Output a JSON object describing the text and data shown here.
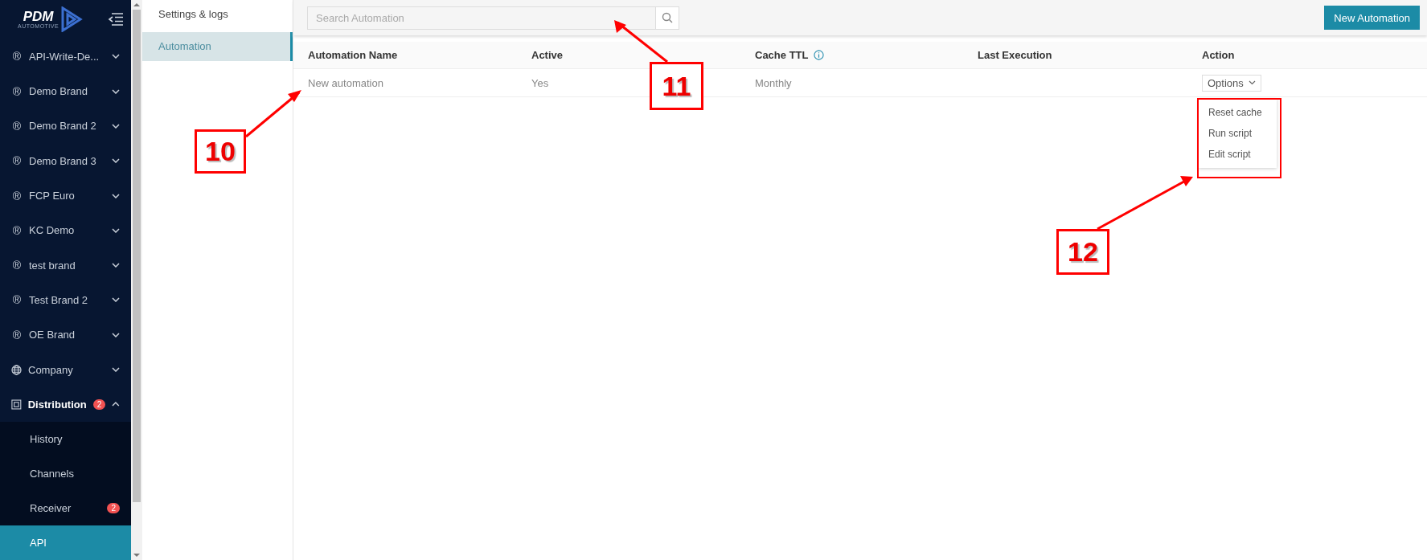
{
  "sidebar": {
    "logo": {
      "name": "PDM",
      "tagline": "AUTOMOTIVE"
    },
    "items": [
      {
        "kind": "brand",
        "icon": "®",
        "label": "API-Write-De...",
        "expanded": false
      },
      {
        "kind": "brand",
        "icon": "®",
        "label": "Demo Brand",
        "expanded": false
      },
      {
        "kind": "brand",
        "icon": "®",
        "label": "Demo Brand 2",
        "expanded": false
      },
      {
        "kind": "brand",
        "icon": "®",
        "label": "Demo Brand 3",
        "expanded": false
      },
      {
        "kind": "brand",
        "icon": "®",
        "label": "FCP Euro",
        "expanded": false
      },
      {
        "kind": "brand",
        "icon": "®",
        "label": "KC Demo",
        "expanded": false
      },
      {
        "kind": "brand",
        "icon": "®",
        "label": "test brand",
        "expanded": false
      },
      {
        "kind": "brand",
        "icon": "®",
        "label": "Test Brand 2",
        "expanded": false
      },
      {
        "kind": "brand",
        "icon": "®",
        "label": "OE Brand",
        "expanded": false
      },
      {
        "kind": "company",
        "label": "Company",
        "expanded": false
      },
      {
        "kind": "distribution",
        "label": "Distribution",
        "badge": "2",
        "expanded": true,
        "children": [
          {
            "label": "History",
            "selected": false
          },
          {
            "label": "Channels",
            "selected": false
          },
          {
            "label": "Receiver",
            "badge": "2",
            "selected": false
          },
          {
            "label": "API",
            "selected": true
          }
        ]
      }
    ]
  },
  "subnav": [
    {
      "label": "Settings & logs",
      "selected": false
    },
    {
      "label": "Automation",
      "selected": true
    }
  ],
  "search": {
    "placeholder": "Search Automation"
  },
  "new_button": "New Automation",
  "table": {
    "columns": [
      {
        "label": "Automation Name"
      },
      {
        "label": "Active"
      },
      {
        "label": "Cache TTL",
        "info": true
      },
      {
        "label": "Last Execution"
      },
      {
        "label": "Action"
      }
    ],
    "rows": [
      {
        "name": "New automation",
        "active": "Yes",
        "cache_ttl": "Monthly",
        "action": "Options"
      }
    ]
  },
  "dropdown": {
    "open": true,
    "items": [
      "Reset cache",
      "Run script",
      "Edit script"
    ]
  },
  "annotations": [
    {
      "label": "10"
    },
    {
      "label": "11"
    },
    {
      "label": "12"
    }
  ]
}
